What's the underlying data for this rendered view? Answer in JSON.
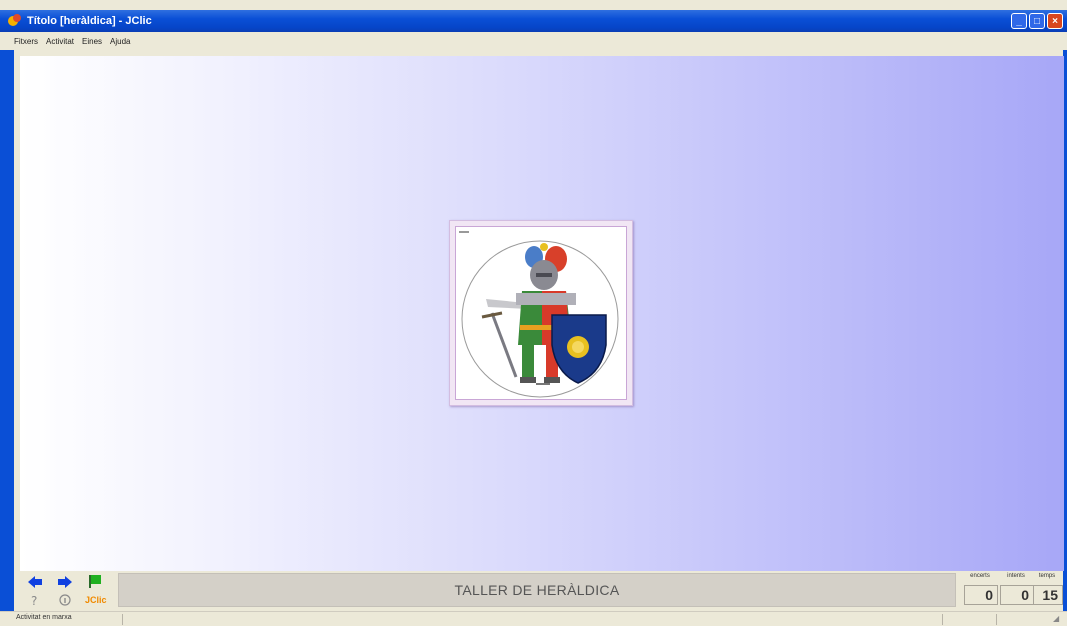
{
  "window": {
    "title": "Títolo [heràldica] - JClic"
  },
  "menu": {
    "items": [
      "Fitxers",
      "Activitat",
      "Eines",
      "Ajuda"
    ]
  },
  "message": {
    "text": "TALLER DE HERÀLDICA"
  },
  "counters": [
    {
      "label": "encerts",
      "value": "0"
    },
    {
      "label": "intents",
      "value": "0"
    },
    {
      "label": "temps",
      "value": "15"
    }
  ],
  "controls": {
    "logo": "JClic"
  },
  "status": {
    "text": "Activitat en marxa"
  },
  "colors": {
    "titlebar": "#0a4fd6",
    "stage_start": "#ffffff",
    "stage_end": "#a7a7f7",
    "card_border": "#c9a6d6"
  }
}
